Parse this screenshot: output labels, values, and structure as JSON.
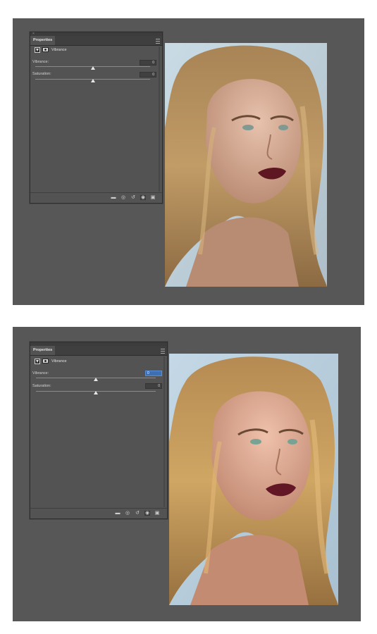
{
  "screens": [
    {
      "panel": {
        "tab_label": "Properties",
        "adjustment_title": "Vibrance",
        "vibrance_label": "Vibrance:",
        "vibrance_value": "0",
        "saturation_label": "Saturation:",
        "saturation_value": "0"
      }
    },
    {
      "panel": {
        "tab_label": "Properties",
        "adjustment_title": "Vibrance",
        "vibrance_label": "Vibrance:",
        "vibrance_value": "0",
        "saturation_label": "Saturation:",
        "saturation_value": "0"
      }
    }
  ],
  "icons": {
    "close": "close-icon",
    "panel_menu": "panel-menu-icon",
    "vibrance_adjustment": "vibrance-triangle-icon",
    "layer_mask": "layer-mask-icon",
    "clip_to_layer": "clip-to-layer-icon",
    "view_previous": "view-previous-state-icon",
    "reset": "reset-icon",
    "visibility": "eye-icon",
    "delete": "trash-icon"
  },
  "colors": {
    "workspace": "#575757",
    "panel": "#535353",
    "field_active": "#3d6fb2"
  },
  "sliders": {
    "screen1": {
      "vibrance": 0,
      "saturation": 0
    },
    "screen2": {
      "vibrance": 0,
      "saturation": 0
    }
  }
}
